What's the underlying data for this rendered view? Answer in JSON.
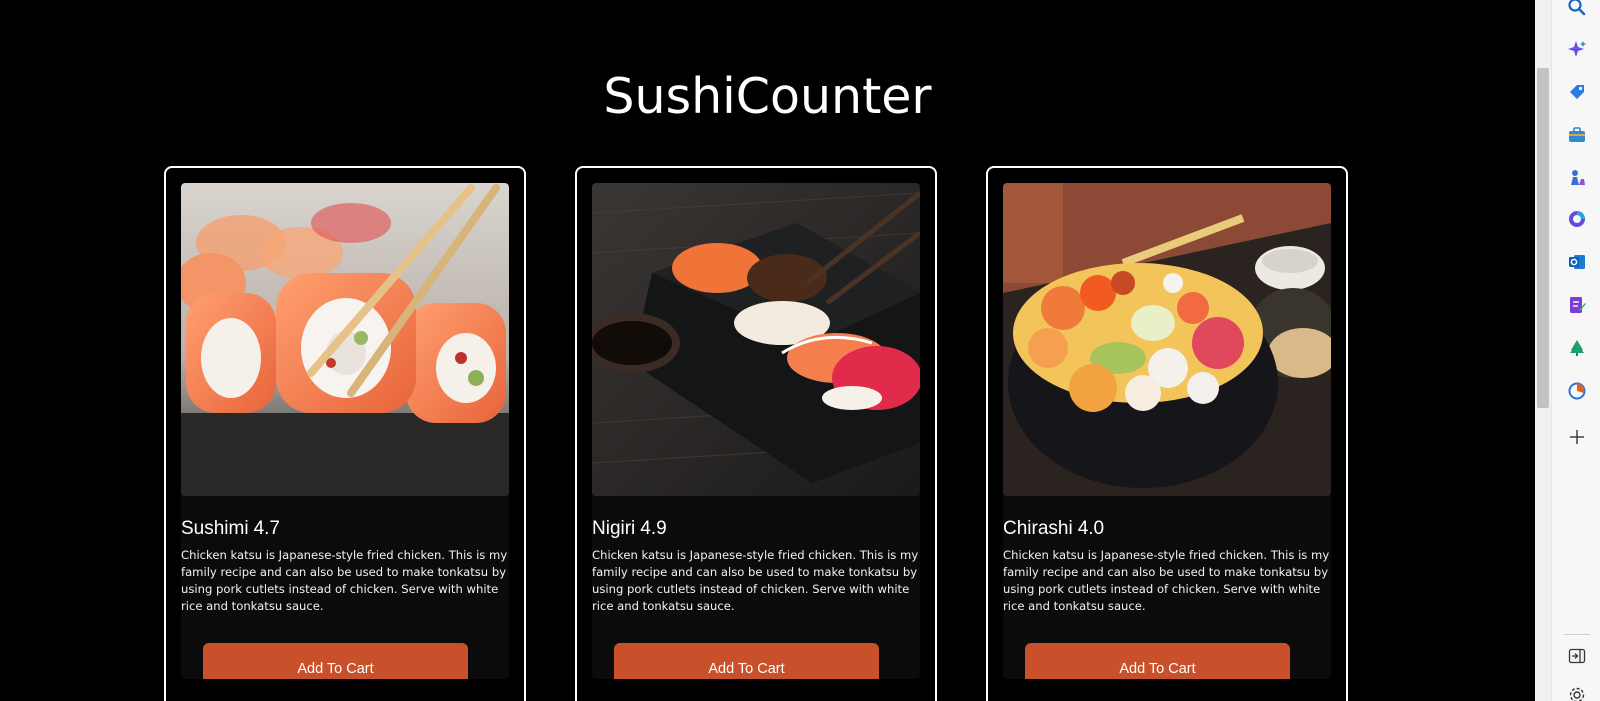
{
  "page": {
    "title": "SushiCounter"
  },
  "cards": [
    {
      "name": "Sushimi",
      "rating": "4.7",
      "description": "Chicken katsu is Japanese-style fried chicken. This is my family recipe and can also be used to make tonkatsu by using pork cutlets instead of chicken. Serve with white rice and tonkatsu sauce.",
      "button_label": "Add To Cart",
      "image": "salmon-sushi-rolls-photo"
    },
    {
      "name": "Nigiri",
      "rating": "4.9",
      "description": "Chicken katsu is Japanese-style fried chicken. This is my family recipe and can also be used to make tonkatsu by using pork cutlets instead of chicken. Serve with white rice and tonkatsu sauce.",
      "button_label": "Add To Cart",
      "image": "nigiri-platter-photo"
    },
    {
      "name": "Chirashi",
      "rating": "4.0",
      "description": "Chicken katsu is Japanese-style fried chicken. This is my family recipe and can also be used to make tonkatsu by using pork cutlets instead of chicken. Serve with white rice and tonkatsu sauce.",
      "button_label": "Add To Cart",
      "image": "chirashi-bowl-photo"
    }
  ],
  "colors": {
    "background": "#000000",
    "button": "#c8502b",
    "card_border": "#ffffff"
  },
  "sidebar": {
    "icons": [
      "search-icon",
      "copilot-sparkle-icon",
      "tag-icon",
      "briefcase-icon",
      "chess-icon",
      "copilot-icon",
      "outlook-icon",
      "notes-icon",
      "tree-icon",
      "browser-essentials-icon",
      "add-icon",
      "split-screen-icon",
      "settings-icon"
    ]
  }
}
